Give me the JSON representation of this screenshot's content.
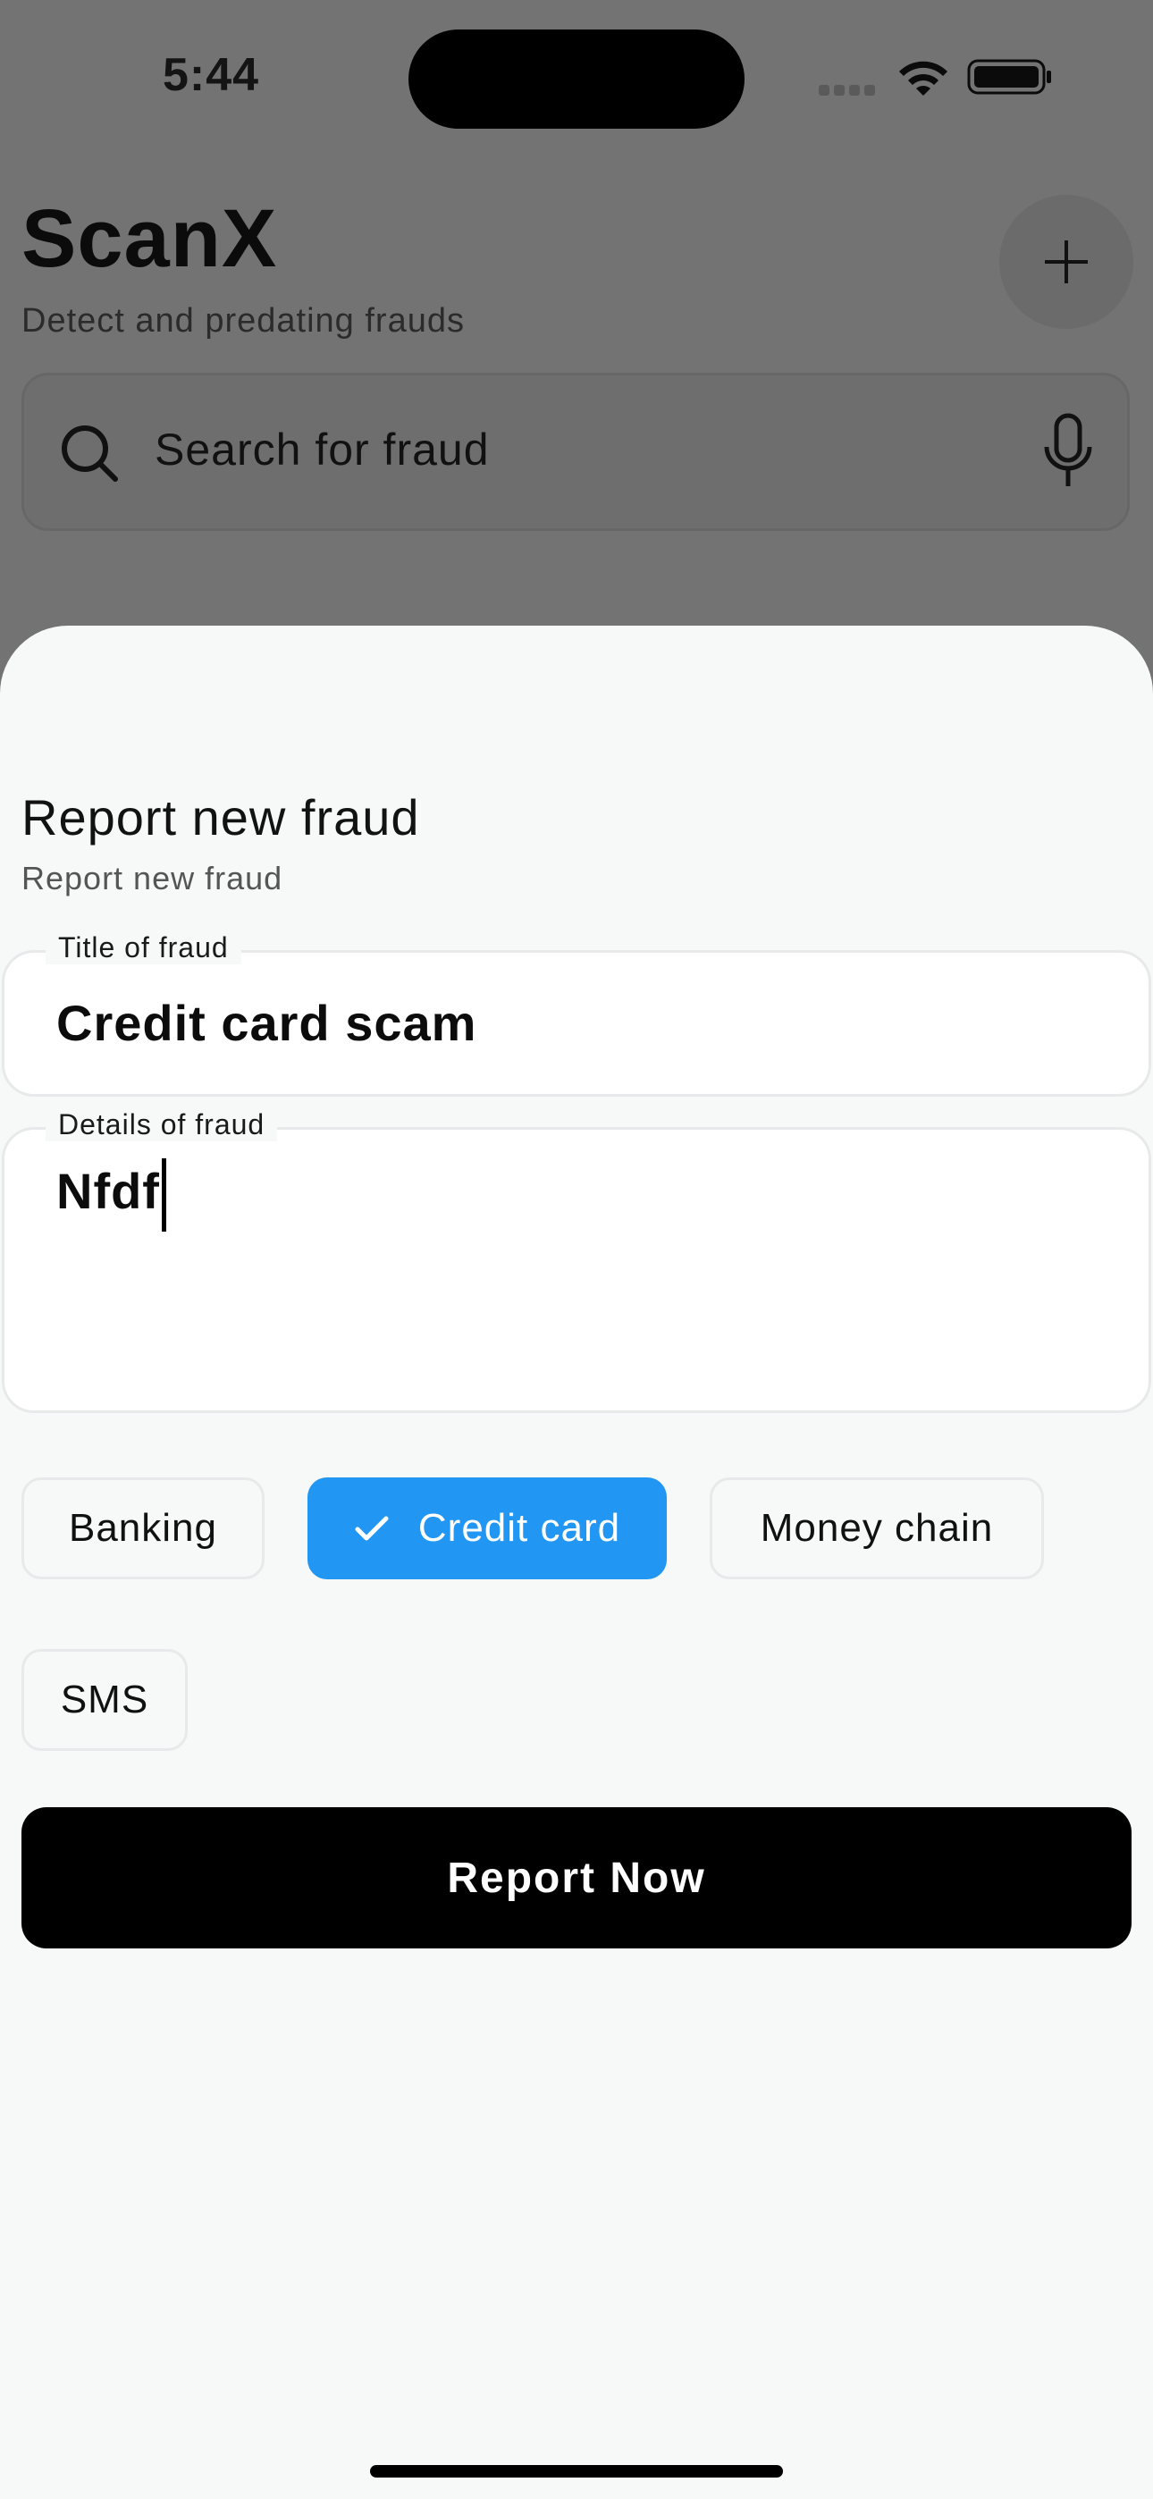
{
  "status_bar": {
    "time": "5:44"
  },
  "header": {
    "title": "ScanX",
    "subtitle": "Detect and predating frauds"
  },
  "search": {
    "placeholder": "Search for fraud"
  },
  "sheet": {
    "title": "Report new fraud",
    "subtitle": "Report new fraud",
    "title_field": {
      "label": "Title of fraud",
      "value": "Credit card scam"
    },
    "details_field": {
      "label": "Details of fraud",
      "value": "Nfdf"
    },
    "categories": [
      {
        "label": "Banking",
        "selected": false
      },
      {
        "label": "Credit card",
        "selected": true
      },
      {
        "label": "Money chain",
        "selected": false
      },
      {
        "label": "SMS",
        "selected": false
      }
    ],
    "submit_label": "Report Now"
  },
  "colors": {
    "accent": "#2196f3",
    "button": "#000000",
    "overlay": "#737373",
    "sheet": "#f7f8f8"
  },
  "icons": [
    "wifi-icon",
    "battery-icon",
    "plus-icon",
    "search-icon",
    "microphone-icon",
    "check-icon"
  ]
}
